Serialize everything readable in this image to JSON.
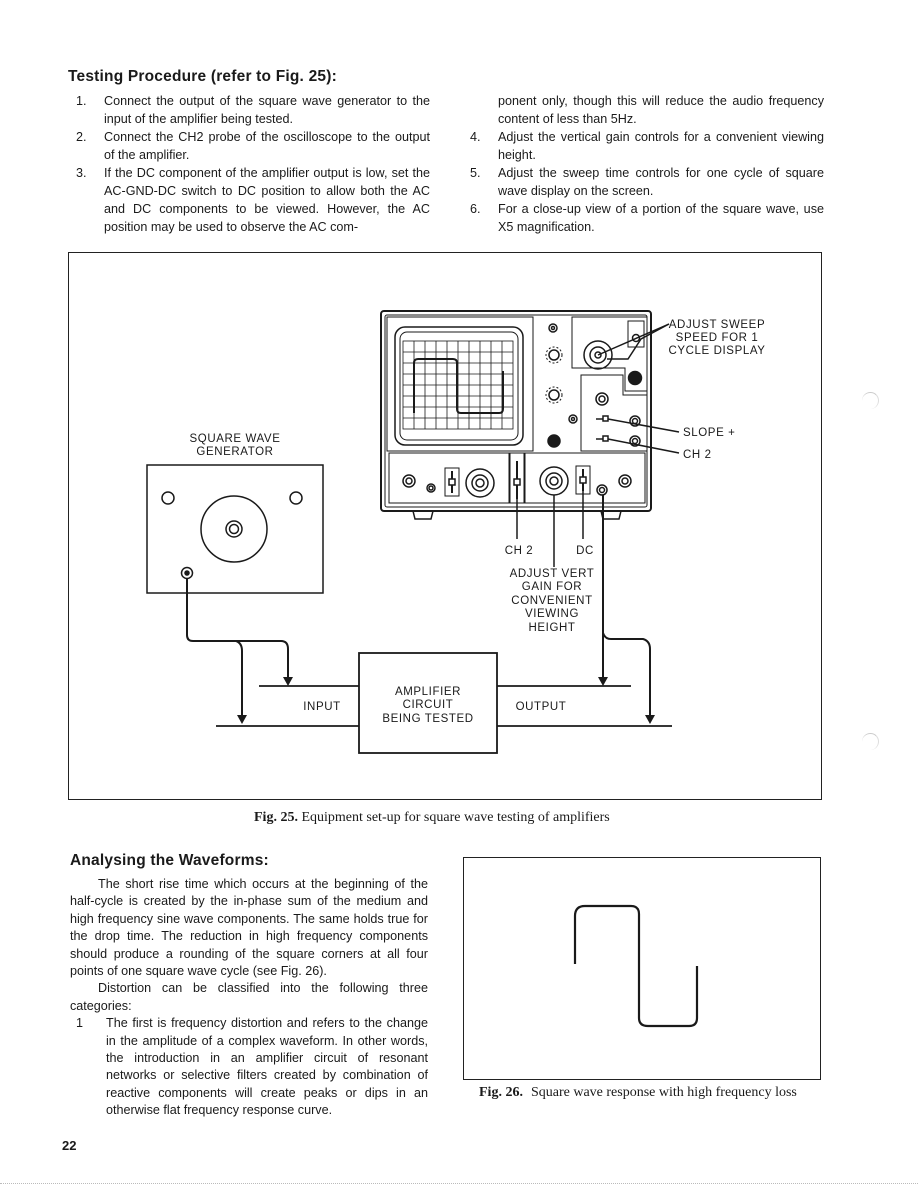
{
  "page": {
    "number": "22"
  },
  "testing": {
    "heading": "Testing Procedure (refer to Fig. 25):",
    "steps": [
      {
        "num": "1.",
        "text": "Connect the output of the square wave generator to the input of the amplifier being tested."
      },
      {
        "num": "2.",
        "text": "Connect the CH2 probe of the oscilloscope to the output of the amplifier."
      },
      {
        "num": "3.",
        "text": "If the DC component of the amplifier output is low, set the AC-GND-DC switch to DC position to allow both the AC and DC components to be viewed.  However, the AC position may be used to observe the AC com-"
      },
      {
        "num": "",
        "text": "ponent only, though this will reduce the audio frequency content of less than 5Hz."
      },
      {
        "num": "4.",
        "text": "Adjust the vertical gain controls for a convenient viewing height."
      },
      {
        "num": "5.",
        "text": "Adjust the sweep time controls for one cycle of square wave display on the screen."
      },
      {
        "num": "6.",
        "text": "For a close-up view of a portion of the square wave, use X5 magnification."
      }
    ]
  },
  "fig25": {
    "labels": {
      "generator_line1": "SQUARE WAVE",
      "generator_line2": "GENERATOR",
      "sweep_line1": "ADJUST SWEEP",
      "sweep_line2": "SPEED FOR 1",
      "sweep_line3": "CYCLE DISPLAY",
      "slope": "SLOPE +",
      "ch2_right": "CH 2",
      "ch2_bottom": "CH 2",
      "dc": "DC",
      "vert_line1": "ADJUST VERT",
      "vert_line2": "GAIN FOR",
      "vert_line3": "CONVENIENT",
      "vert_line4": "VIEWING",
      "vert_line5": "HEIGHT",
      "amp_line1": "AMPLIFIER",
      "amp_line2": "CIRCUIT",
      "amp_line3": "BEING TESTED",
      "input": "INPUT",
      "output": "OUTPUT"
    },
    "caption_label": "Fig. 25.",
    "caption_text": "Equipment set-up for square wave testing of amplifiers"
  },
  "analysing": {
    "heading": "Analysing the Waveforms:",
    "paragraph1": "The short rise time which occurs at the beginning of the half-cycle is created by the in-phase sum of the medium and high frequency sine wave components.  The same holds true for the drop time.  The reduction in high frequency components should produce  a rounding of the square corners at all four points of one square wave cycle (see Fig. 26).",
    "paragraph2": "Distortion can be classified into the following three categories:",
    "items": [
      {
        "num": "1",
        "text": "The first is frequency distortion and refers to the change in the amplitude of a complex waveform.  In other words, the introduction in an amplifier circuit of resonant networks or selective filters created by combination of reactive components will create peaks or dips in an otherwise flat frequency response curve."
      }
    ]
  },
  "fig26": {
    "caption_label": "Fig. 26.",
    "caption_text": "Square wave response with high frequency loss"
  }
}
